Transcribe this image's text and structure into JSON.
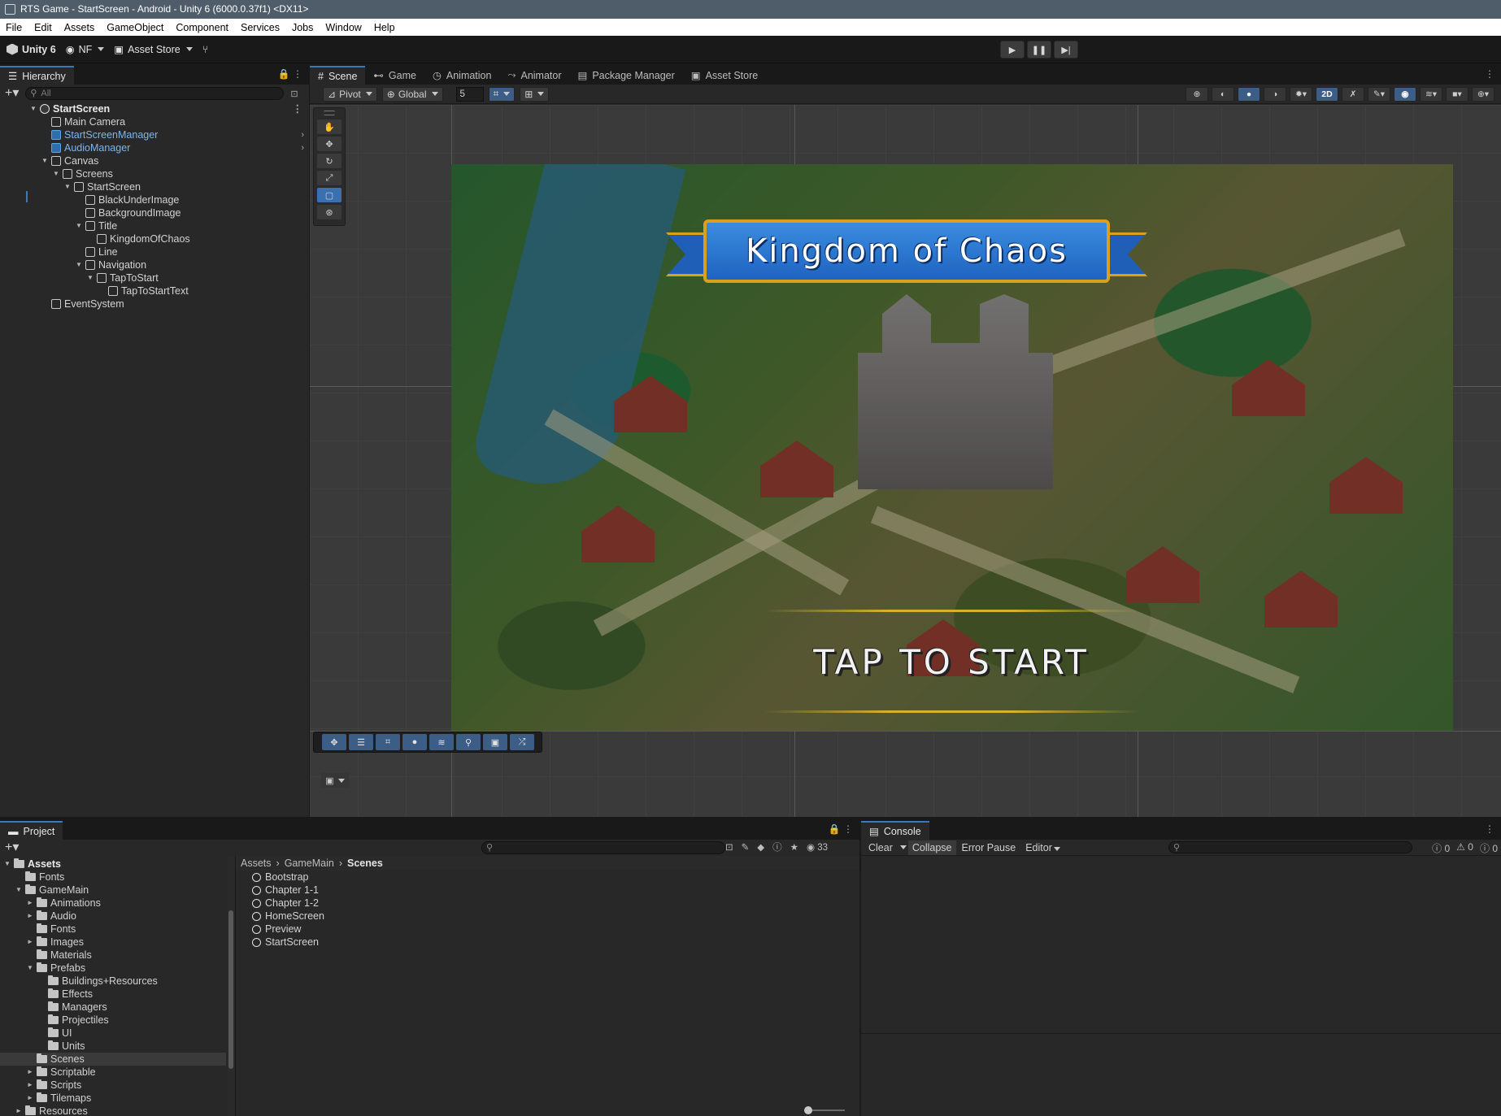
{
  "titlebar": {
    "title": "RTS Game - StartScreen - Android - Unity 6 (6000.0.37f1) <DX11>"
  },
  "menu": [
    "File",
    "Edit",
    "Assets",
    "GameObject",
    "Component",
    "Services",
    "Jobs",
    "Window",
    "Help"
  ],
  "toolbar": {
    "unity_label": "Unity 6",
    "account_label": "NF",
    "asset_store_label": "Asset Store"
  },
  "hierarchy": {
    "tab_label": "Hierarchy",
    "search_placeholder": "All",
    "rows": [
      {
        "label": "StartScreen",
        "indent": 0,
        "arrow": "▼",
        "icon": "scene",
        "style": "bold",
        "menu": true
      },
      {
        "label": "Main Camera",
        "indent": 1,
        "arrow": "",
        "icon": "cube",
        "style": ""
      },
      {
        "label": "StartScreenManager",
        "indent": 1,
        "arrow": "",
        "icon": "prefab",
        "style": "prefab",
        "chevron": true
      },
      {
        "label": "AudioManager",
        "indent": 1,
        "arrow": "",
        "icon": "prefab",
        "style": "prefab",
        "chevron": true
      },
      {
        "label": "Canvas",
        "indent": 1,
        "arrow": "▼",
        "icon": "cube",
        "style": ""
      },
      {
        "label": "Screens",
        "indent": 2,
        "arrow": "▼",
        "icon": "cube",
        "style": ""
      },
      {
        "label": "StartScreen",
        "indent": 3,
        "arrow": "▼",
        "icon": "cube",
        "style": ""
      },
      {
        "label": "BlackUnderImage",
        "indent": 4,
        "arrow": "",
        "icon": "cube",
        "style": ""
      },
      {
        "label": "BackgroundImage",
        "indent": 4,
        "arrow": "",
        "icon": "cube",
        "style": ""
      },
      {
        "label": "Title",
        "indent": 4,
        "arrow": "▼",
        "icon": "cube",
        "style": ""
      },
      {
        "label": "KingdomOfChaos",
        "indent": 5,
        "arrow": "",
        "icon": "cube",
        "style": ""
      },
      {
        "label": "Line",
        "indent": 4,
        "arrow": "",
        "icon": "cube",
        "style": ""
      },
      {
        "label": "Navigation",
        "indent": 4,
        "arrow": "▼",
        "icon": "cube",
        "style": ""
      },
      {
        "label": "TapToStart",
        "indent": 5,
        "arrow": "▼",
        "icon": "cube",
        "style": ""
      },
      {
        "label": "TapToStartText",
        "indent": 6,
        "arrow": "",
        "icon": "cube",
        "style": ""
      },
      {
        "label": "EventSystem",
        "indent": 1,
        "arrow": "",
        "icon": "cube",
        "style": ""
      }
    ]
  },
  "tabs": [
    "Scene",
    "Game",
    "Animation",
    "Animator",
    "Package Manager",
    "Asset Store"
  ],
  "scene_toolbar": {
    "pivot": "Pivot",
    "global": "Global",
    "grid_size": "5",
    "mode_2d": "2D"
  },
  "game": {
    "title": "Kingdom of Chaos",
    "tap_text": "TAP TO START"
  },
  "project": {
    "tab_label": "Project",
    "hidden_count": "33",
    "tree": [
      {
        "label": "Assets",
        "indent": 0,
        "arrow": "▼",
        "bold": true,
        "sel": false
      },
      {
        "label": "Fonts",
        "indent": 1,
        "arrow": "",
        "bold": false,
        "sel": false
      },
      {
        "label": "GameMain",
        "indent": 1,
        "arrow": "▼",
        "bold": false,
        "sel": false
      },
      {
        "label": "Animations",
        "indent": 2,
        "arrow": "►",
        "bold": false,
        "sel": false
      },
      {
        "label": "Audio",
        "indent": 2,
        "arrow": "►",
        "bold": false,
        "sel": false
      },
      {
        "label": "Fonts",
        "indent": 2,
        "arrow": "",
        "bold": false,
        "sel": false
      },
      {
        "label": "Images",
        "indent": 2,
        "arrow": "►",
        "bold": false,
        "sel": false
      },
      {
        "label": "Materials",
        "indent": 2,
        "arrow": "",
        "bold": false,
        "sel": false
      },
      {
        "label": "Prefabs",
        "indent": 2,
        "arrow": "▼",
        "bold": false,
        "sel": false
      },
      {
        "label": "Buildings+Resources",
        "indent": 3,
        "arrow": "",
        "bold": false,
        "sel": false
      },
      {
        "label": "Effects",
        "indent": 3,
        "arrow": "",
        "bold": false,
        "sel": false
      },
      {
        "label": "Managers",
        "indent": 3,
        "arrow": "",
        "bold": false,
        "sel": false
      },
      {
        "label": "Projectiles",
        "indent": 3,
        "arrow": "",
        "bold": false,
        "sel": false
      },
      {
        "label": "UI",
        "indent": 3,
        "arrow": "",
        "bold": false,
        "sel": false
      },
      {
        "label": "Units",
        "indent": 3,
        "arrow": "",
        "bold": false,
        "sel": false
      },
      {
        "label": "Scenes",
        "indent": 2,
        "arrow": "",
        "bold": false,
        "sel": true
      },
      {
        "label": "Scriptable",
        "indent": 2,
        "arrow": "►",
        "bold": false,
        "sel": false
      },
      {
        "label": "Scripts",
        "indent": 2,
        "arrow": "►",
        "bold": false,
        "sel": false
      },
      {
        "label": "Tilemaps",
        "indent": 2,
        "arrow": "►",
        "bold": false,
        "sel": false
      },
      {
        "label": "Resources",
        "indent": 1,
        "arrow": "►",
        "bold": false,
        "sel": false
      }
    ],
    "breadcrumb": [
      "Assets",
      "GameMain",
      "Scenes"
    ],
    "files": [
      "Bootstrap",
      "Chapter 1-1",
      "Chapter 1-2",
      "HomeScreen",
      "Preview",
      "StartScreen"
    ]
  },
  "console": {
    "tab_label": "Console",
    "buttons": [
      "Clear",
      "Collapse",
      "Error Pause",
      "Editor"
    ],
    "counts": {
      "info": "0",
      "warn": "0",
      "error": "0"
    }
  },
  "colors": {
    "accent": "#3a79bb",
    "prefab_text": "#7cb5f2",
    "banner_blue": "#1f63c0",
    "banner_gold": "#d9a11b"
  }
}
